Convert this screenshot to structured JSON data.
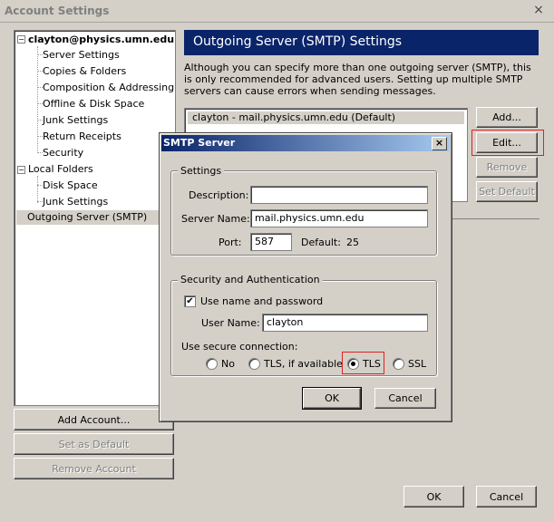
{
  "window": {
    "title": "Account Settings",
    "close_glyph": "×"
  },
  "tree": {
    "account": "clayton@physics.umn.edu",
    "account_items": [
      "Server Settings",
      "Copies & Folders",
      "Composition & Addressing",
      "Offline & Disk Space",
      "Junk Settings",
      "Return Receipts",
      "Security"
    ],
    "local_folders": "Local Folders",
    "local_items": [
      "Disk Space",
      "Junk Settings"
    ],
    "outgoing": "Outgoing Server (SMTP)",
    "expander_glyph": "−"
  },
  "left_buttons": {
    "add_account": "Add Account...",
    "set_default": "Set as Default",
    "remove_account": "Remove Account"
  },
  "panel": {
    "heading": "Outgoing Server (SMTP) Settings",
    "description": "Although you can specify more than one outgoing server (SMTP), this is only recommended for advanced users. Setting up multiple SMTP servers can cause errors when sending messages.",
    "servers": [
      "clayton - mail.physics.umn.edu (Default)"
    ],
    "buttons": {
      "add": "Add...",
      "edit": "Edit...",
      "remove": "Remove",
      "set_default": "Set Default"
    }
  },
  "dialog": {
    "title": "SMTP Server",
    "close_glyph": "×",
    "settings_group": "Settings",
    "description_label": "Description:",
    "description_value": "",
    "server_name_label": "Server Name:",
    "server_name_value": "mail.physics.umn.edu",
    "port_label": "Port:",
    "port_value": "587",
    "default_label": "Default:",
    "default_port": "25",
    "security_group": "Security and Authentication",
    "use_name_label": "Use name and password",
    "use_name_checked": true,
    "check_glyph": "✔",
    "username_label": "User Name:",
    "username_value": "clayton",
    "secure_conn_label": "Use secure connection:",
    "radio_no": "No",
    "radio_tls_if": "TLS, if available",
    "radio_tls": "TLS",
    "radio_ssl": "SSL",
    "selected_connection": "TLS",
    "ok": "OK",
    "cancel": "Cancel"
  },
  "footer": {
    "ok": "OK",
    "cancel": "Cancel"
  },
  "colors": {
    "panel_header": "#0a246a",
    "highlight": "#e02020",
    "face": "#d4d0c8"
  }
}
